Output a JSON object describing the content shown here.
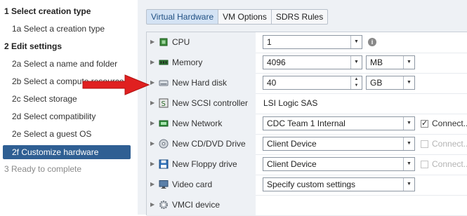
{
  "nav": {
    "step1": "1 Select creation type",
    "step1a": "1a Select a creation type",
    "step2": "2 Edit settings",
    "step2a": "2a Select a name and folder",
    "step2b": "2b Select a compute resource",
    "step2c": "2c Select storage",
    "step2d": "2d Select compatibility",
    "step2e": "2e Select a guest OS",
    "step2f": "2f Customize hardware",
    "step3": "3 Ready to complete"
  },
  "tabs": [
    "Virtual Hardware",
    "VM Options",
    "SDRS Rules"
  ],
  "rows": {
    "cpu": {
      "label": "CPU",
      "value": "1"
    },
    "memory": {
      "label": "Memory",
      "value": "4096",
      "unit": "MB"
    },
    "disk": {
      "label": "New Hard disk",
      "value": "40",
      "unit": "GB"
    },
    "scsi": {
      "label": "New SCSI controller",
      "value": "LSI Logic SAS"
    },
    "network": {
      "label": "New Network",
      "value": "CDC Team 1 Internal",
      "connect": "Connect..."
    },
    "cddvd": {
      "label": "New CD/DVD Drive",
      "value": "Client Device",
      "connect": "Connect..."
    },
    "floppy": {
      "label": "New Floppy drive",
      "value": "Client Device",
      "connect": "Connect..."
    },
    "video": {
      "label": "Video card",
      "value": "Specify custom settings"
    },
    "vmci": {
      "label": "VMCI device"
    }
  },
  "colors": {
    "active_step_bg": "#2f5f93",
    "arrow": "#e02020",
    "panel_bg": "#eef1f5"
  },
  "icons": {
    "cpu": "chip-icon",
    "memory": "memory-icon",
    "disk": "hard-disk-icon",
    "scsi": "scsi-controller-icon",
    "network": "network-icon",
    "cddvd": "cd-dvd-icon",
    "floppy": "floppy-icon",
    "video": "monitor-icon",
    "vmci": "gear-icon"
  }
}
